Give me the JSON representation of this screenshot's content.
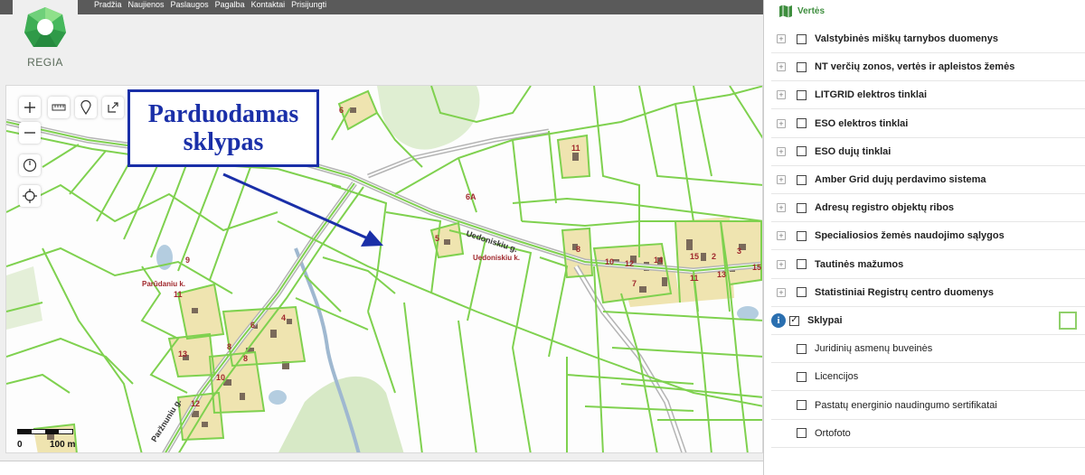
{
  "nav": {
    "items": [
      "Pradžia",
      "Naujienos",
      "Paslaugos",
      "Pagalba",
      "Kontaktai",
      "Prisijungti"
    ]
  },
  "logo": {
    "label": "REGIA"
  },
  "map": {
    "annotation": [
      "Parduodamas",
      "sklypas"
    ],
    "scale": {
      "start": "0",
      "end": "100 m"
    },
    "roads": [
      "Uedoniskiu g.",
      "Paržnuniu g."
    ],
    "place_labels": [
      "Parūdaniu k.",
      "Uedoniskiu k."
    ],
    "plot_numbers": [
      "6",
      "11",
      "6A",
      "5",
      "9",
      "11",
      "8",
      "10",
      "12",
      "14",
      "15",
      "2",
      "3",
      "15",
      "4",
      "6",
      "8",
      "8",
      "13",
      "10",
      "12",
      "7",
      "11",
      "13"
    ]
  },
  "panel": {
    "title": "Vertės",
    "layers": [
      {
        "label": "Valstybinės miškų tarnybos duomenys",
        "checked": false,
        "expandable": true
      },
      {
        "label": "NT verčių zonos, vertės ir apleistos žemės",
        "checked": false,
        "expandable": true
      },
      {
        "label": "LITGRID elektros tinklai",
        "checked": false,
        "expandable": true
      },
      {
        "label": "ESO elektros tinklai",
        "checked": false,
        "expandable": true
      },
      {
        "label": "ESO dujų tinklai",
        "checked": false,
        "expandable": true
      },
      {
        "label": "Amber Grid dujų perdavimo sistema",
        "checked": false,
        "expandable": true
      },
      {
        "label": "Adresų registro objektų ribos",
        "checked": false,
        "expandable": true
      },
      {
        "label": "Specialiosios žemės naudojimo sąlygos",
        "checked": false,
        "expandable": true
      },
      {
        "label": "Tautinės mažumos",
        "checked": false,
        "expandable": true
      },
      {
        "label": "Statistiniai Registrų centro duomenys",
        "checked": false,
        "expandable": true
      },
      {
        "label": "Sklypai",
        "checked": true,
        "expandable": false,
        "info": true
      },
      {
        "label": "Juridinių asmenų buveinės",
        "checked": false,
        "expandable": false
      },
      {
        "label": "Licencijos",
        "checked": false,
        "expandable": false
      },
      {
        "label": "Pastatų energinio naudingumo sertifikatai",
        "checked": false,
        "expandable": false
      },
      {
        "label": "Ortofoto",
        "checked": false,
        "expandable": false
      }
    ]
  },
  "colors": {
    "parcel_line": "#7fd14f",
    "road": "#b0b0b0",
    "annotation": "#1a2fa8",
    "building_lot": "#efe4b0"
  }
}
